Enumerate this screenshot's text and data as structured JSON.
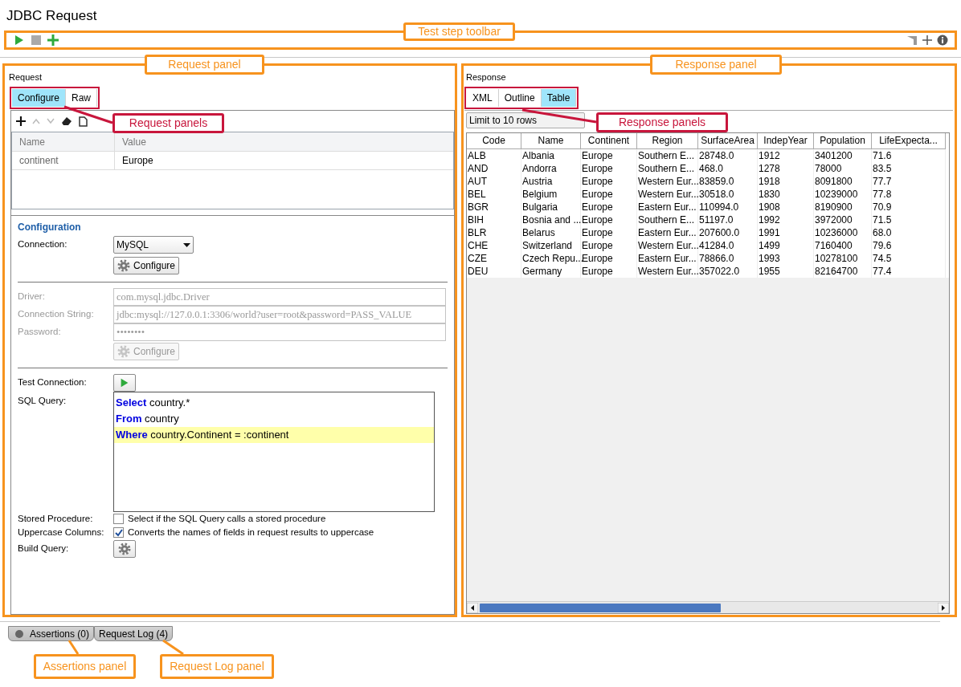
{
  "title": "JDBC Request",
  "request": {
    "heading": "Request",
    "tabs": [
      {
        "label": "Configure",
        "selected": true
      },
      {
        "label": "Raw",
        "selected": false
      }
    ],
    "properties": {
      "columns": [
        "Name",
        "Value"
      ],
      "rows": [
        [
          "continent",
          "Europe"
        ]
      ]
    },
    "configuration": {
      "heading": "Configuration",
      "connection": {
        "label": "Connection:",
        "value": "MySQL",
        "button": "Configure"
      },
      "driver_fields": [
        {
          "label": "Driver:",
          "value": "com.mysql.jdbc.Driver",
          "disabled": true
        },
        {
          "label": "Connection String:",
          "value": "jdbc:mysql://127.0.0.1:3306/world?user=root&password=PASS_VALUE",
          "disabled": true
        },
        {
          "label": "Password:",
          "value": "••••••••",
          "disabled": true
        }
      ],
      "driver_button": {
        "label": "Configure",
        "disabled": true
      },
      "test_connection": {
        "label": "Test Connection:"
      },
      "sql": {
        "label": "SQL Query:",
        "lines": [
          {
            "text": "**Select** country.*",
            "highlighted": false
          },
          {
            "text": "**From** country",
            "highlighted": false
          },
          {
            "text": "**Where** country.Continent = :continent",
            "highlighted": true
          }
        ]
      },
      "options": [
        {
          "label": "Stored Procedure:",
          "text": "Select if the SQL Query calls a stored procedure",
          "checked": false
        },
        {
          "label": "Uppercase Columns:",
          "text": "Converts the names of fields in request results to uppercase",
          "checked": true
        }
      ],
      "build_query": {
        "label": "Build Query:"
      }
    }
  },
  "response": {
    "heading": "Response",
    "tabs": [
      {
        "label": "XML",
        "selected": false
      },
      {
        "label": "Outline",
        "selected": false
      },
      {
        "label": "Table",
        "selected": true
      }
    ],
    "limit": "Limit to 10 rows",
    "table": {
      "columns": [
        "Code",
        "Name",
        "Continent",
        "Region",
        "SurfaceArea",
        "IndepYear",
        "Population",
        "LifeExpecta..."
      ],
      "rows": [
        [
          "ALB",
          "Albania",
          "Europe",
          "Southern E...",
          "28748.0",
          "1912",
          "3401200",
          "71.6"
        ],
        [
          "AND",
          "Andorra",
          "Europe",
          "Southern E...",
          "468.0",
          "1278",
          "78000",
          "83.5"
        ],
        [
          "AUT",
          "Austria",
          "Europe",
          "Western Eur...",
          "83859.0",
          "1918",
          "8091800",
          "77.7"
        ],
        [
          "BEL",
          "Belgium",
          "Europe",
          "Western Eur...",
          "30518.0",
          "1830",
          "10239000",
          "77.8"
        ],
        [
          "BGR",
          "Bulgaria",
          "Europe",
          "Eastern Eur...",
          "110994.0",
          "1908",
          "8190900",
          "70.9"
        ],
        [
          "BIH",
          "Bosnia and ...",
          "Europe",
          "Southern E...",
          "51197.0",
          "1992",
          "3972000",
          "71.5"
        ],
        [
          "BLR",
          "Belarus",
          "Europe",
          "Eastern Eur...",
          "207600.0",
          "1991",
          "10236000",
          "68.0"
        ],
        [
          "CHE",
          "Switzerland",
          "Europe",
          "Western Eur...",
          "41284.0",
          "1499",
          "7160400",
          "79.6"
        ],
        [
          "CZE",
          "Czech Repu...",
          "Europe",
          "Eastern Eur...",
          "78866.0",
          "1993",
          "10278100",
          "74.5"
        ],
        [
          "DEU",
          "Germany",
          "Europe",
          "Western Eur...",
          "357022.0",
          "1955",
          "82164700",
          "77.4"
        ]
      ]
    }
  },
  "bottom_tabs": [
    {
      "label": "Assertions (0)",
      "kind": "status"
    },
    {
      "label": "Request Log (4)",
      "kind": "plain"
    }
  ],
  "annotations": [
    {
      "text": "Test step toolbar",
      "color": "#f7931e"
    },
    {
      "text": "Request panel",
      "color": "#f7931e"
    },
    {
      "text": "Response panel",
      "color": "#f7931e"
    },
    {
      "text": "Request panels",
      "color": "#c8163c"
    },
    {
      "text": "Response panels",
      "color": "#c8163c"
    },
    {
      "text": "Assertions panel",
      "color": "#f7931e"
    },
    {
      "text": "Request Log panel",
      "color": "#f7931e"
    }
  ]
}
